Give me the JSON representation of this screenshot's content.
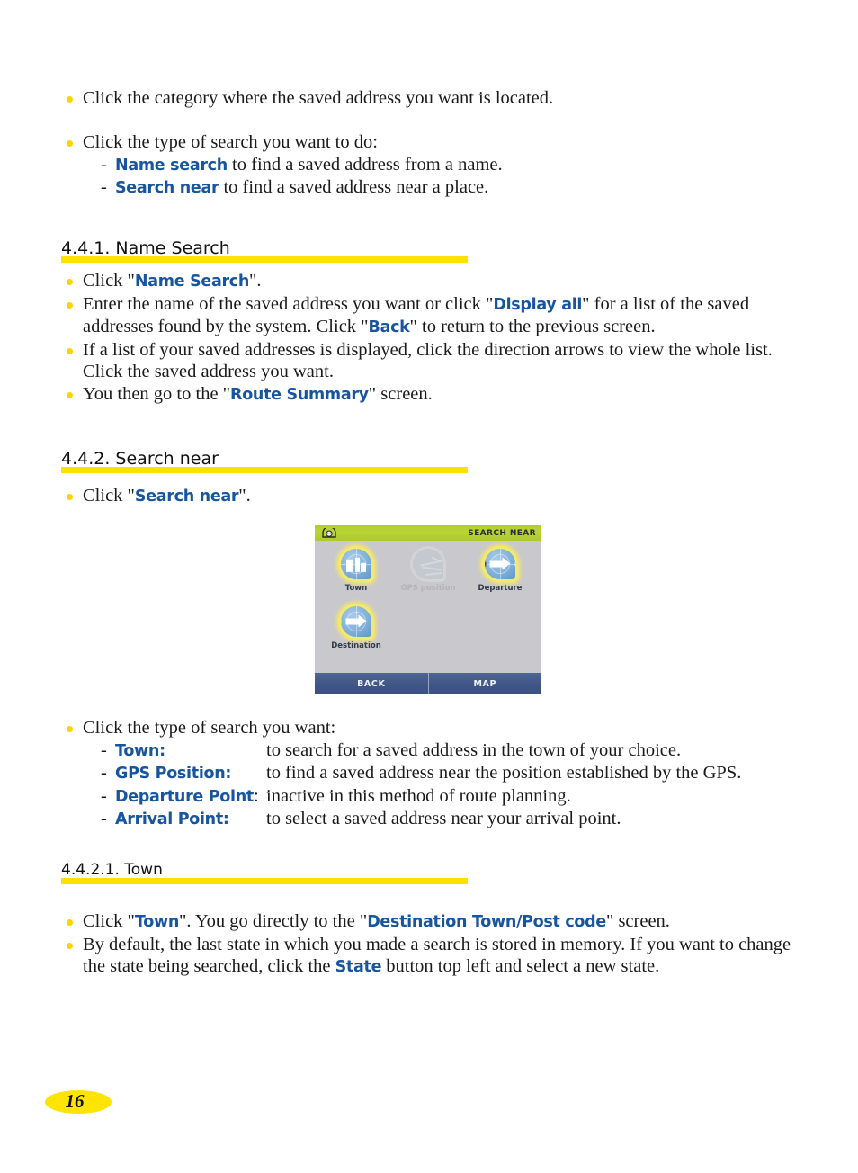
{
  "page": {
    "number": "16"
  },
  "intro": {
    "bullet1": "Click the category where the saved address you want is located.",
    "bullet2": "Click the type of search you want to do:",
    "sub1_link": "Name search",
    "sub1_rest": " to find a saved address from a name.",
    "sub2_link": "Search near",
    "sub2_rest": " to find a saved address near a place."
  },
  "section_441": {
    "heading": "4.4.1. Name Search",
    "bullets": {
      "b1_pre": "Click \"",
      "b1_link": "Name Search",
      "b1_post": "\".",
      "b2_pre": "Enter the name of the saved address you want or click \"",
      "b2_link1": "Display all",
      "b2_mid": "\" for a list of the saved addresses found by the system. Click \"",
      "b2_link2": "Back",
      "b2_post": "\" to return to the previous screen.",
      "b3": "If a list of your saved addresses is displayed, click the direction arrows to view the whole list. Click the saved address you want.",
      "b4_pre": "You then go to the \"",
      "b4_link": "Route Summary",
      "b4_post": "\" screen."
    }
  },
  "section_442": {
    "heading": "4.4.2. Search near",
    "bullet1_pre": "Click \"",
    "bullet1_link": "Search near",
    "bullet1_post": "\".",
    "device": {
      "status_icon": "car-tunnel-icon",
      "title": "SEARCH NEAR",
      "tiles": [
        {
          "label": "Town",
          "icon": "town-buildings-icon",
          "state": "enabled"
        },
        {
          "label": "GPS position",
          "icon": "gps-map-icon",
          "state": "disabled"
        },
        {
          "label": "Departure",
          "icon": "departure-arrow-icon",
          "state": "enabled"
        },
        {
          "label": "Destination",
          "icon": "destination-arrow-icon",
          "state": "enabled"
        }
      ],
      "buttons": [
        {
          "label": "BACK"
        },
        {
          "label": "MAP"
        }
      ]
    },
    "list_intro": "Click the type of search you want:",
    "options": [
      {
        "term": "Town",
        "colon": ":",
        "desc": "to search for a saved address in the town of your choice."
      },
      {
        "term": "GPS Position",
        "colon": ":",
        "desc": "to find a saved address near the position established by the GPS."
      },
      {
        "term": "Departure Point",
        "colon": ":",
        "desc": "inactive in this method of route planning."
      },
      {
        "term": "Arrival Point",
        "colon": ":",
        "desc": "to select a saved address near your arrival point."
      }
    ]
  },
  "section_4421": {
    "heading": "4.4.2.1. Town",
    "b1_pre": "Click \"",
    "b1_link1": "Town",
    "b1_mid": "\". You go directly to the \"",
    "b1_link2": "Destination Town/Post code",
    "b1_post": "\" screen.",
    "b2_pre": "By default, the last state in which you made a search is stored in memory. If you want to change the state being searched, click the ",
    "b2_link": "State",
    "b2_post": " button top left and select a new state."
  },
  "colors": {
    "link_blue": "#17559e",
    "bullet_yellow": "#ffd400",
    "heading_bar_yellow": "#ffe000",
    "device_titlebar_green": "#b5d334",
    "device_button_blue": "#3f5585",
    "device_background": "#c9c8cd",
    "pin_glow_yellow": "#f3e96a",
    "marker_dark_red": "#8d1d2c"
  }
}
